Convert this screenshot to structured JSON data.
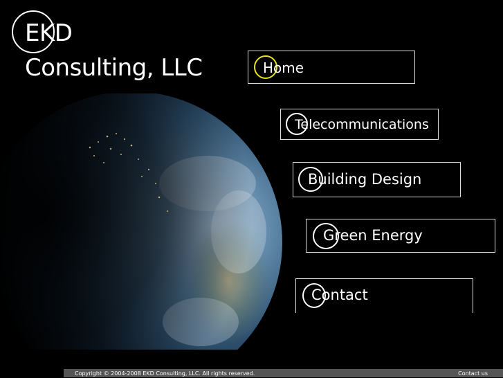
{
  "logo": {
    "line1": "EKD",
    "line2": "Consulting, LLC"
  },
  "nav": {
    "items": [
      {
        "label": "Home",
        "active": true
      },
      {
        "label": "Telecommunications"
      },
      {
        "label": "Building Design"
      },
      {
        "label": "Green Energy"
      },
      {
        "label": "Contact"
      }
    ]
  },
  "footer": {
    "copyright": "Copyright © 2004-2008 EKD Consulting, LLC. All rights reserved.",
    "contact_link": "Contact us"
  },
  "colors": {
    "background": "#000000",
    "active_ring": "#e8e420",
    "ring": "#ffffff",
    "footer_bg": "#555555"
  }
}
